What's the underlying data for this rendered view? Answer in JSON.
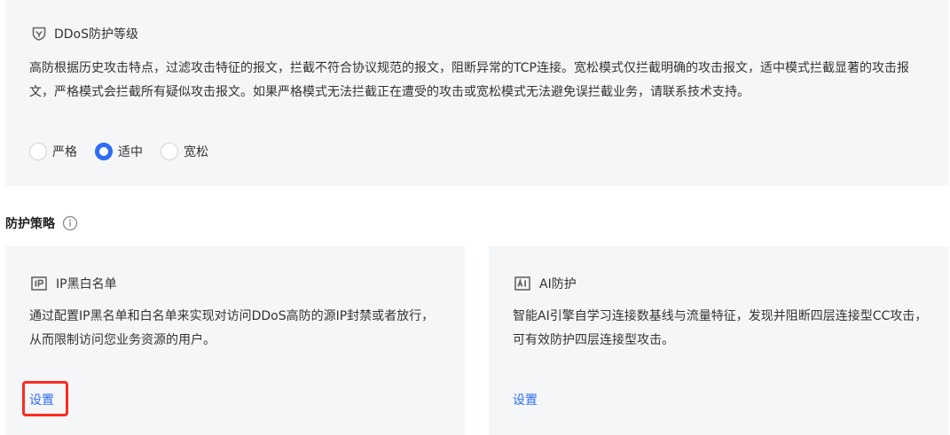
{
  "ddos": {
    "title": "DDoS防护等级",
    "description": "高防根据历史攻击特点，过滤攻击特征的报文，拦截不符合协议规范的报文，阻断异常的TCP连接。宽松模式仅拦截明确的攻击报文，适中模式拦截显著的攻击报文，严格模式会拦截所有疑似攻击报文。如果严格模式无法拦截正在遭受的攻击或宽松模式无法避免误拦截业务，请联系技术支持。",
    "options": [
      {
        "label": "严格",
        "checked": false
      },
      {
        "label": "适中",
        "checked": true
      },
      {
        "label": "宽松",
        "checked": false
      }
    ]
  },
  "section": {
    "title": "防护策略",
    "info_icon": "info-circle-icon"
  },
  "cards": {
    "ip": {
      "icon": "ip-icon",
      "title": "IP黑白名单",
      "description": "通过配置IP黑名单和白名单来实现对访问DDoS高防的源IP封禁或者放行，从而限制访问您业务资源的用户。",
      "link": "设置"
    },
    "ai": {
      "icon": "ai-icon",
      "title": "AI防护",
      "description": "智能AI引擎自学习连接数基线与流量特征，发现并阻断四层连接型CC攻击，可有效防护四层连接型攻击。",
      "link": "设置"
    }
  },
  "colors": {
    "accent": "#2d6cf5",
    "highlight": "#ff2b1f",
    "panel_bg": "#f5f6f8"
  }
}
